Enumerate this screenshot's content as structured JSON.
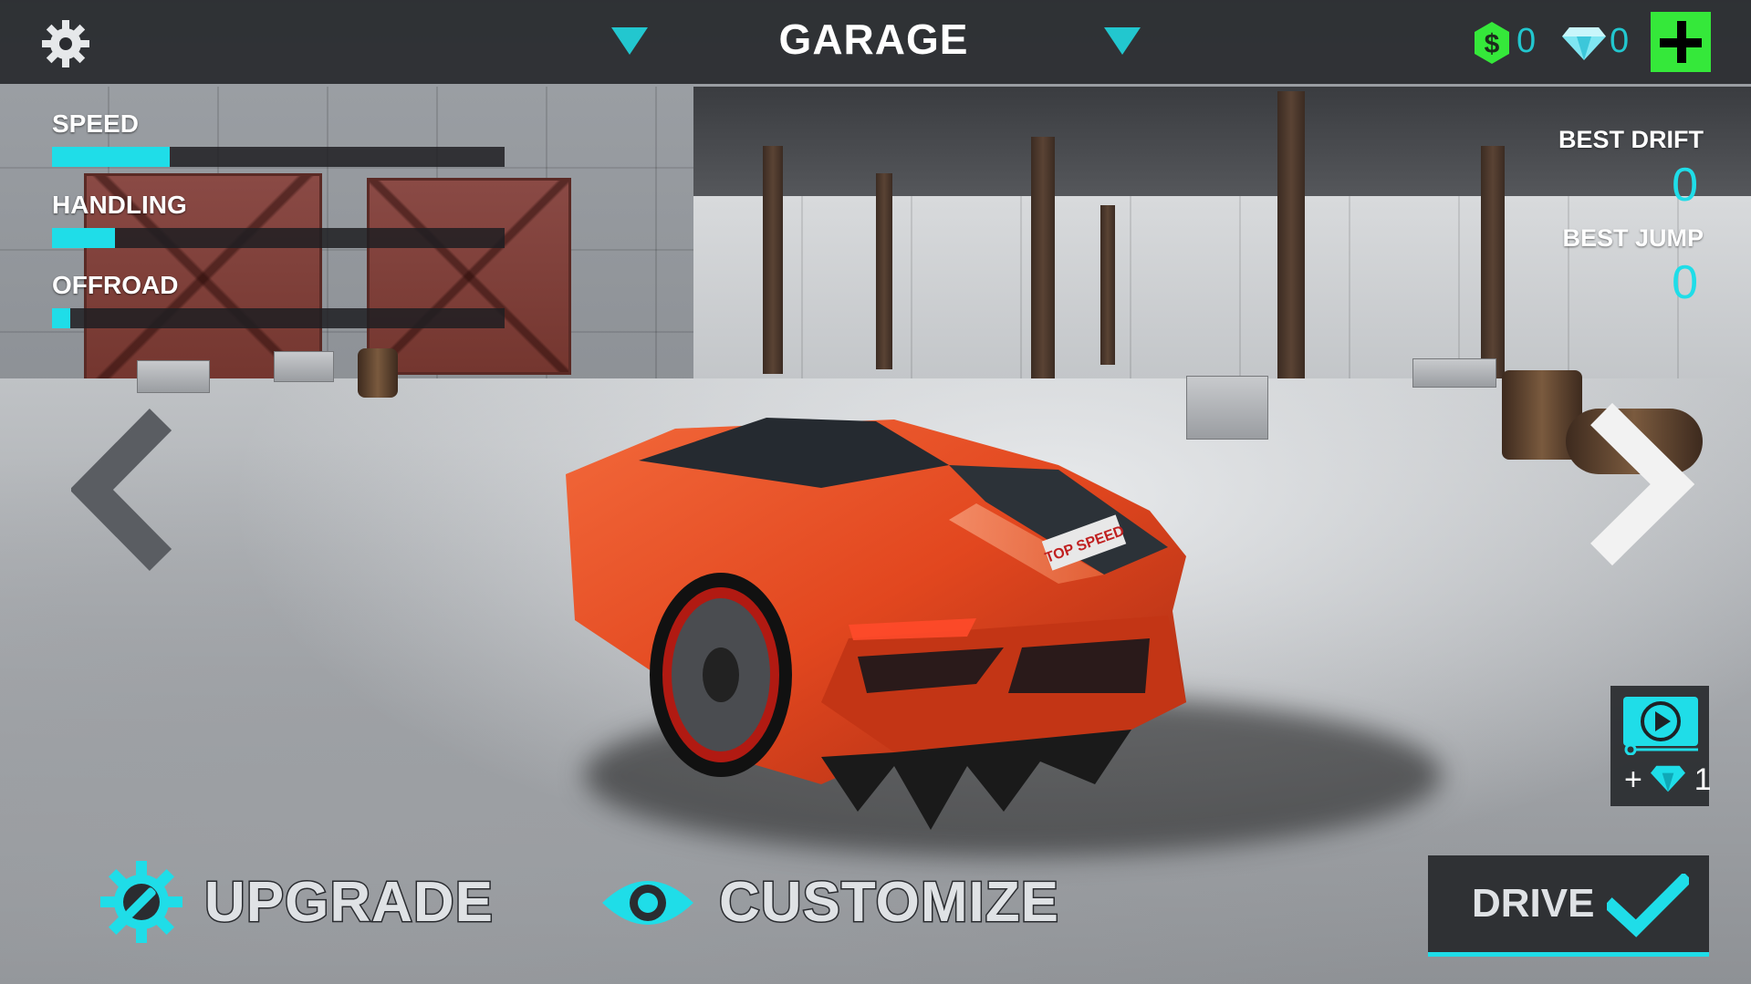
{
  "header": {
    "title": "GARAGE",
    "cash": "0",
    "diamonds": "0"
  },
  "stats": [
    {
      "label": "SPEED",
      "value": 0.26
    },
    {
      "label": "HANDLING",
      "value": 0.14
    },
    {
      "label": "OFFROAD",
      "value": 0.04
    }
  ],
  "records": {
    "best_drift_label": "BEST DRIFT",
    "best_drift_value": "0",
    "best_jump_label": "BEST JUMP",
    "best_jump_value": "0"
  },
  "video_reward": {
    "prefix": "+",
    "amount": "1"
  },
  "actions": {
    "upgrade": "UPGRADE",
    "customize": "CUSTOMIZE",
    "drive": "DRIVE"
  },
  "car": {
    "plate_text": "TOP SPEED",
    "color": "#e2471f"
  },
  "colors": {
    "accent": "#1fdde8",
    "plus": "#35e83a",
    "cash": "#35e83a"
  }
}
